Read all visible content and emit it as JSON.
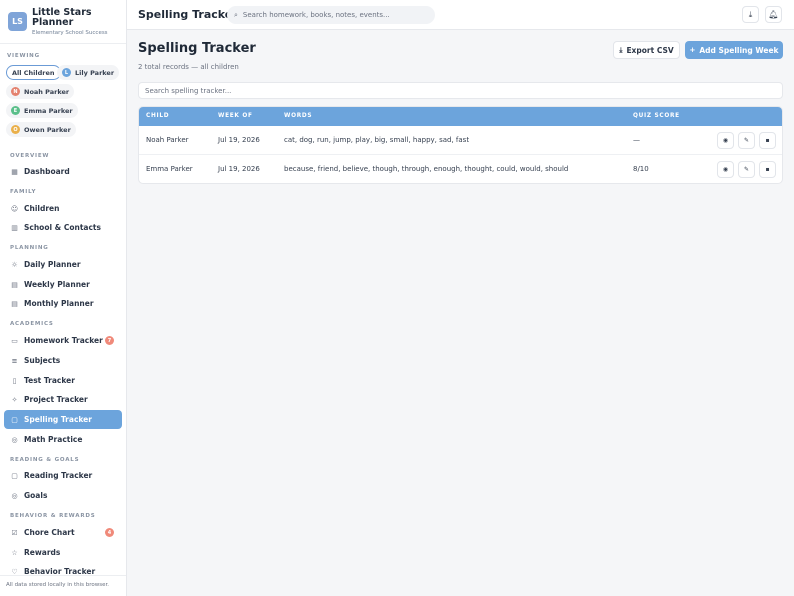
{
  "app": {
    "logo_initials": "LS",
    "name": "Little Stars Planner",
    "subtitle": "Elementary School Success"
  },
  "viewing": {
    "label": "VIEWING",
    "chips": [
      {
        "label": "All Children",
        "active": true
      },
      {
        "label": "Lily Parker",
        "initial": "L",
        "color": "#6ca4dc"
      },
      {
        "label": "Noah Parker",
        "initial": "N",
        "color": "#e4826f"
      },
      {
        "label": "Emma Parker",
        "initial": "E",
        "color": "#5bbf8a"
      },
      {
        "label": "Owen Parker",
        "initial": "O",
        "color": "#eab04a"
      }
    ]
  },
  "sidebar": {
    "sections": {
      "overview": "OVERVIEW",
      "family": "FAMILY",
      "planning": "PLANNING",
      "academics": "ACADEMICS",
      "reading_goals": "READING & GOALS",
      "behavior_rewards": "BEHAVIOR & REWARDS"
    },
    "items": {
      "dashboard": "Dashboard",
      "children": "Children",
      "school_contacts": "School & Contacts",
      "daily_planner": "Daily Planner",
      "weekly_planner": "Weekly Planner",
      "monthly_planner": "Monthly Planner",
      "homework_tracker": "Homework Tracker",
      "homework_badge": "7",
      "subjects": "Subjects",
      "test_tracker": "Test Tracker",
      "project_tracker": "Project Tracker",
      "spelling_tracker": "Spelling Tracker",
      "math_practice": "Math Practice",
      "reading_tracker": "Reading Tracker",
      "goals": "Goals",
      "chore_chart": "Chore Chart",
      "chore_badge": "4",
      "rewards": "Rewards",
      "behavior_tracker": "Behavior Tracker"
    },
    "footer": "All data stored locally in this browser."
  },
  "topbar": {
    "title": "Spelling Tracker",
    "search_placeholder": "Search homework, books, notes, events..."
  },
  "main": {
    "title": "Spelling Tracker",
    "subtitle": "2 total records — all children",
    "export_label": "Export CSV",
    "add_label": "Add Spelling Week",
    "table_search_placeholder": "Search spelling tracker...",
    "columns": {
      "child": "CHILD",
      "week_of": "WEEK OF",
      "words": "WORDS",
      "quiz_score": "QUIZ SCORE"
    },
    "rows": [
      {
        "child": "Noah Parker",
        "week_of": "Jul 19, 2026",
        "words": "cat, dog, run, jump, play, big, small, happy, sad, fast",
        "quiz_score": "—"
      },
      {
        "child": "Emma Parker",
        "week_of": "Jul 19, 2026",
        "words": "because, friend, believe, though, through, enough, thought, could, would, should",
        "quiz_score": "8/10"
      }
    ]
  },
  "colors": {
    "accent": "#6ca4dc",
    "badge": "#f08a7a"
  }
}
